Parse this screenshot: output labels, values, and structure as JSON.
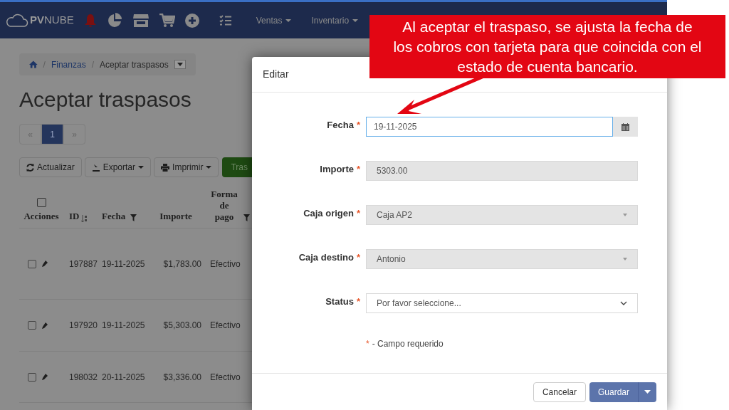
{
  "navbar": {
    "brand_bold": "PV",
    "brand_light": "NUBE",
    "menus": [
      {
        "label": "Ventas"
      },
      {
        "label": "Inventario"
      }
    ]
  },
  "breadcrumb": {
    "separator": "/",
    "items": [
      "Finanzas",
      "Aceptar traspasos"
    ]
  },
  "page_title": "Aceptar traspasos",
  "pagination": [
    {
      "label": "«",
      "selected": false
    },
    {
      "label": "1",
      "selected": true
    },
    {
      "label": "»",
      "selected": false
    }
  ],
  "toolbar": [
    {
      "label": "Actualizar",
      "kind": "refresh"
    },
    {
      "label": "Exportar",
      "kind": "export"
    },
    {
      "label": "Imprimir",
      "kind": "print"
    },
    {
      "label": "Tras",
      "kind": "primary"
    }
  ],
  "table": {
    "actions_header": "Acciones",
    "select_all_checked": false,
    "columns": [
      "ID",
      "Fecha",
      "Importe",
      "Forma de pago"
    ],
    "rows": [
      {
        "checked": false,
        "cells": [
          "197887",
          "19-11-2025",
          "$1,783.00",
          "Efectivo"
        ]
      },
      {
        "checked": false,
        "cells": [
          "197920",
          "19-11-2025",
          "$5,303.00",
          "Efectivo"
        ]
      },
      {
        "checked": false,
        "cells": [
          "198032",
          "20-11-2025",
          "$3,336.00",
          "Efectivo"
        ]
      }
    ]
  },
  "modal": {
    "title": "Editar",
    "required_mark": "*",
    "fields": [
      {
        "label": "Fecha",
        "required": true,
        "kind": "date",
        "value": "19-11-2025",
        "focused": true
      },
      {
        "label": "Importe",
        "required": true,
        "kind": "readonly",
        "value": "5303.00",
        "focused": false
      },
      {
        "label": "Caja origen",
        "required": true,
        "kind": "readonly_select",
        "value": "Caja AP2",
        "focused": false
      },
      {
        "label": "Caja destino",
        "required": true,
        "kind": "readonly_select",
        "value": "Antonio",
        "focused": false
      },
      {
        "label": "Status",
        "required": true,
        "kind": "select",
        "placeholder": "Por favor seleccione...",
        "focused": false
      }
    ],
    "required_note": "- Campo requerido",
    "buttons": {
      "cancel": "Cancelar",
      "save": "Guardar"
    }
  },
  "callout": {
    "text": "Al aceptar el traspaso, se ajusta la fecha de los cobros con tarjeta para que coincida con el estado de cuenta bancario."
  }
}
